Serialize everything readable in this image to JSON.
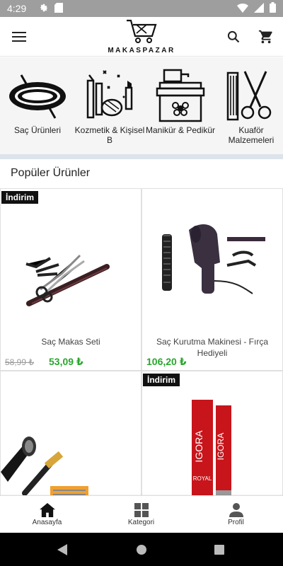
{
  "status_bar": {
    "time": "4:29",
    "icons": [
      "gear-icon",
      "sd-card-icon",
      "wifi-icon",
      "signal-icon",
      "battery-icon"
    ]
  },
  "app_bar": {
    "logo_text": "MAKASPAZAR",
    "icons": [
      "menu-icon",
      "search-icon",
      "cart-icon"
    ]
  },
  "categories": [
    {
      "label": "Saç Ürünleri",
      "icon": "hair-tie-icon"
    },
    {
      "label": "Kozmetik & Kişisel B",
      "icon": "cosmetics-icon"
    },
    {
      "label": "Manikür & Pedikür",
      "icon": "manicure-icon"
    },
    {
      "label": "Kuaför Malzemeleri",
      "icon": "comb-scissors-icon"
    }
  ],
  "section_title": "Popüler Ürünler",
  "products": [
    {
      "badge": "İndirim",
      "name": "Saç Makas Seti",
      "old_price": "58,99 ₺",
      "price": "53,09 ₺"
    },
    {
      "badge": "",
      "name": "Saç Kurutma Makinesi - Fırça Hediyeli",
      "old_price": "",
      "price": "106,20 ₺"
    },
    {
      "badge": "",
      "name": "",
      "old_price": "",
      "price": ""
    },
    {
      "badge": "İndirim",
      "name": "",
      "old_price": "",
      "price": ""
    }
  ],
  "product_image_text": {
    "igora_brand": "IGORA",
    "igora_sub": "ROYAL"
  },
  "bottom_nav": [
    {
      "label": "Anasayfa",
      "icon": "home-icon",
      "active": true
    },
    {
      "label": "Kategori",
      "icon": "category-grid-icon",
      "active": false
    },
    {
      "label": "Profil",
      "icon": "person-icon",
      "active": false
    }
  ],
  "colors": {
    "price_green": "#2aa52e",
    "badge_black": "#111111",
    "status_bar_gray": "#9e9e9e",
    "category_bg": "#f5f5f5"
  }
}
